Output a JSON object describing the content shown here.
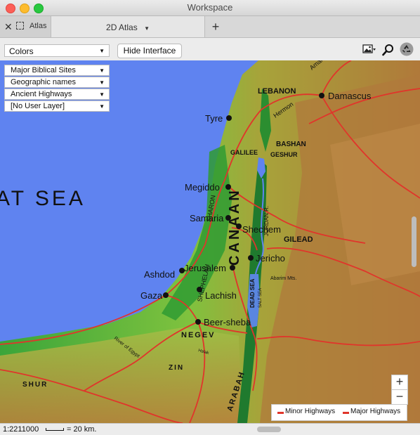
{
  "window": {
    "title": "Workspace"
  },
  "tabs": {
    "atlas_label": "Atlas",
    "map_tab_label": "2D Atlas",
    "add_label": "+"
  },
  "toolbar": {
    "colors_value": "Colors",
    "hide_interface_label": "Hide Interface"
  },
  "layers": [
    {
      "value": "Major Biblical Sites"
    },
    {
      "value": "Geographic names"
    },
    {
      "value": "Ancient Highways"
    },
    {
      "value": "[No User Layer]"
    }
  ],
  "map": {
    "sea_label": "AT SEA",
    "regions": [
      "LEBANON",
      "BASHAN",
      "GESHUR",
      "GALILEE",
      "CANAAN",
      "SHARON",
      "SHEPHELAH",
      "GILEAD",
      "NEGEV",
      "ZIN",
      "SHUR",
      "ARABAH",
      "Hermon",
      "Amana",
      "Abarim Mts.",
      "DEAD SEA",
      "SALT SEA",
      "JORDAN R.",
      "River of Egypt",
      "Halak"
    ],
    "sites": [
      {
        "name": "Damascus"
      },
      {
        "name": "Tyre"
      },
      {
        "name": "Megiddo"
      },
      {
        "name": "Samaria"
      },
      {
        "name": "Shechem"
      },
      {
        "name": "Jericho"
      },
      {
        "name": "Jerusalem"
      },
      {
        "name": "Ashdod"
      },
      {
        "name": "Gaza"
      },
      {
        "name": "Lachish"
      },
      {
        "name": "Beer-sheba"
      }
    ]
  },
  "legend": {
    "minor_label": "Minor Highways",
    "major_label": "Major Highways",
    "highway_color": "#e0352b"
  },
  "zoom": {
    "in_label": "+",
    "out_label": "−"
  },
  "status": {
    "scale_ratio": "1:2211000",
    "scale_label": "= 20 km."
  }
}
